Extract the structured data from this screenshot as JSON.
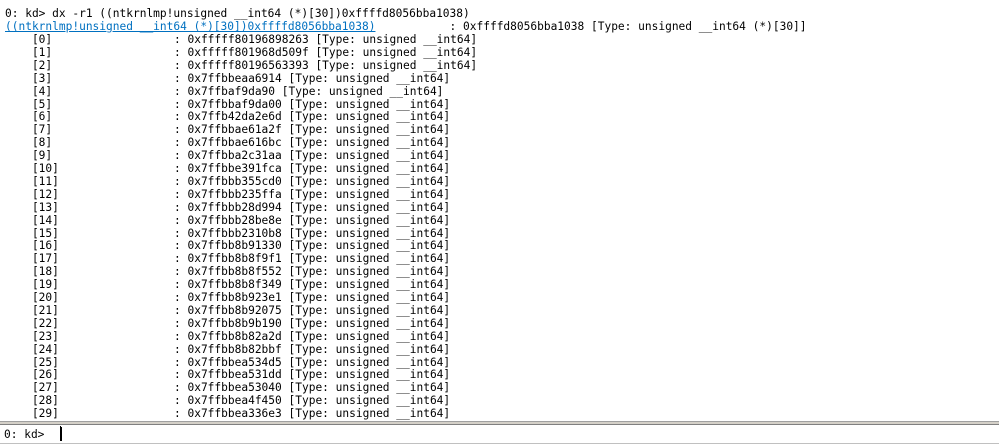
{
  "output": {
    "command": "0: kd> dx -r1 ((ntkrnlmp!unsigned __int64 (*)[30])0xffffd8056bba1038)",
    "expression_link": "((ntkrnlmp!unsigned __int64 (*)[30])0xffffd8056bba1038)",
    "expression_value": "           : 0xffffd8056bba1038 [Type: unsigned __int64 (*)[30]]",
    "rows": [
      {
        "index": "[0]",
        "value": ": 0xfffff80196898263 [Type: unsigned __int64]"
      },
      {
        "index": "[1]",
        "value": ": 0xfffff801968d509f [Type: unsigned __int64]"
      },
      {
        "index": "[2]",
        "value": ": 0xfffff80196563393 [Type: unsigned __int64]"
      },
      {
        "index": "[3]",
        "value": ": 0x7ffbbeaa6914 [Type: unsigned __int64]"
      },
      {
        "index": "[4]",
        "value": ": 0x7ffbaf9da90 [Type: unsigned __int64]"
      },
      {
        "index": "[5]",
        "value": ": 0x7ffbbaf9da00 [Type: unsigned __int64]"
      },
      {
        "index": "[6]",
        "value": ": 0x7ffb42da2e6d [Type: unsigned __int64]"
      },
      {
        "index": "[7]",
        "value": ": 0x7ffbbae61a2f [Type: unsigned __int64]"
      },
      {
        "index": "[8]",
        "value": ": 0x7ffbbae616bc [Type: unsigned __int64]"
      },
      {
        "index": "[9]",
        "value": ": 0x7ffbba2c31aa [Type: unsigned __int64]"
      },
      {
        "index": "[10]",
        "value": ": 0x7ffbbe391fca [Type: unsigned __int64]"
      },
      {
        "index": "[11]",
        "value": ": 0x7ffbbb355cd0 [Type: unsigned __int64]"
      },
      {
        "index": "[12]",
        "value": ": 0x7ffbbb235ffa [Type: unsigned __int64]"
      },
      {
        "index": "[13]",
        "value": ": 0x7ffbbb28d994 [Type: unsigned __int64]"
      },
      {
        "index": "[14]",
        "value": ": 0x7ffbbb28be8e [Type: unsigned __int64]"
      },
      {
        "index": "[15]",
        "value": ": 0x7ffbbb2310b8 [Type: unsigned __int64]"
      },
      {
        "index": "[16]",
        "value": ": 0x7ffbb8b91330 [Type: unsigned __int64]"
      },
      {
        "index": "[17]",
        "value": ": 0x7ffbb8b8f9f1 [Type: unsigned __int64]"
      },
      {
        "index": "[18]",
        "value": ": 0x7ffbb8b8f552 [Type: unsigned __int64]"
      },
      {
        "index": "[19]",
        "value": ": 0x7ffbb8b8f349 [Type: unsigned __int64]"
      },
      {
        "index": "[20]",
        "value": ": 0x7ffbb8b923e1 [Type: unsigned __int64]"
      },
      {
        "index": "[21]",
        "value": ": 0x7ffbb8b92075 [Type: unsigned __int64]"
      },
      {
        "index": "[22]",
        "value": ": 0x7ffbb8b9b190 [Type: unsigned __int64]"
      },
      {
        "index": "[23]",
        "value": ": 0x7ffbb8b82a2d [Type: unsigned __int64]"
      },
      {
        "index": "[24]",
        "value": ": 0x7ffbb8b82bbf [Type: unsigned __int64]"
      },
      {
        "index": "[25]",
        "value": ": 0x7ffbbea534d5 [Type: unsigned __int64]"
      },
      {
        "index": "[26]",
        "value": ": 0x7ffbbea531dd [Type: unsigned __int64]"
      },
      {
        "index": "[27]",
        "value": ": 0x7ffbbea53040 [Type: unsigned __int64]"
      },
      {
        "index": "[28]",
        "value": ": 0x7ffbbea4f450 [Type: unsigned __int64]"
      },
      {
        "index": "[29]",
        "value": ": 0x7ffbbea336e3 [Type: unsigned __int64]"
      }
    ]
  },
  "command_bar": {
    "prompt": "0: kd>",
    "input_value": ""
  },
  "colors": {
    "link": "#0070c0",
    "text": "#000000",
    "background": "#ffffff"
  }
}
